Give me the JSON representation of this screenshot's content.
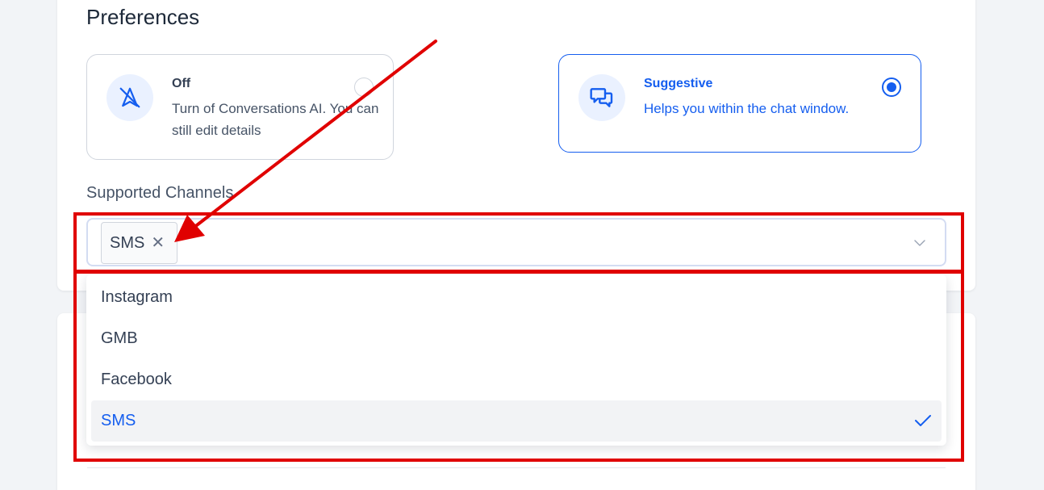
{
  "preferences": {
    "title": "Preferences",
    "options": [
      {
        "id": "off",
        "title": "Off",
        "description": "Turn of Conversations AI. You can still edit details",
        "selected": false,
        "icon": "navigation-off-icon"
      },
      {
        "id": "suggestive",
        "title": "Suggestive",
        "description": "Helps you within the chat window.",
        "selected": true,
        "icon": "chat-bubbles-icon"
      }
    ]
  },
  "channels": {
    "label": "Supported Channels",
    "selected_tags": [
      {
        "label": "SMS"
      }
    ],
    "options": [
      {
        "label": "Instagram",
        "selected": false
      },
      {
        "label": "GMB",
        "selected": false
      },
      {
        "label": "Facebook",
        "selected": false
      },
      {
        "label": "SMS",
        "selected": true
      }
    ]
  },
  "colors": {
    "accent": "#155eef",
    "annotation": "#e00000",
    "background": "#f2f4f7"
  }
}
